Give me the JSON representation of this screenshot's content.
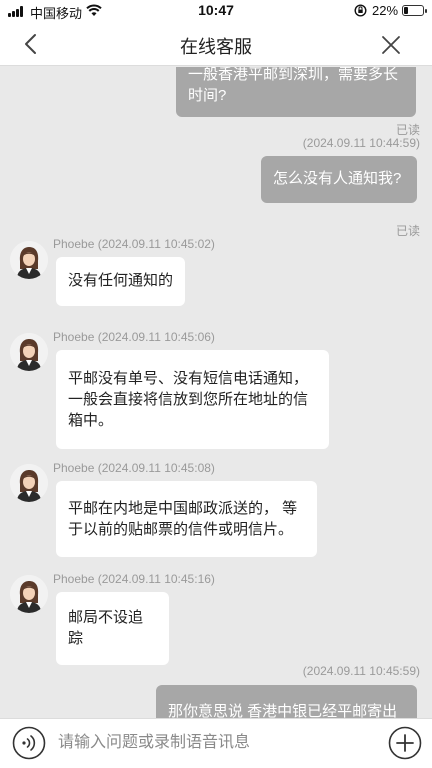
{
  "status_bar": {
    "carrier": "中国移动",
    "time": "10:47",
    "battery_text": "22%",
    "battery_level": 0.22
  },
  "nav": {
    "title": "在线客服"
  },
  "messages": [
    {
      "side": "out",
      "text": "一般香港平邮到深圳，需要多长时间?",
      "read": "已读",
      "time": "(2024.09.11 10:44:59)"
    },
    {
      "side": "out",
      "text": "怎么没有人通知我?",
      "read": "已读"
    },
    {
      "side": "in",
      "sender_time": "Phoebe (2024.09.11 10:45:02)",
      "text": "没有任何通知的"
    },
    {
      "side": "in",
      "sender_time": "Phoebe (2024.09.11 10:45:06)",
      "text": "平邮没有单号、没有短信电话通知，一般会直接将信放到您所在地址的信箱中。"
    },
    {
      "side": "in",
      "sender_time": "Phoebe (2024.09.11 10:45:08)",
      "text": "平邮在内地是中国邮政派送的， 等于以前的贴邮票的信件或明信片。"
    },
    {
      "side": "in",
      "sender_time": "Phoebe (2024.09.11 10:45:16)",
      "text": "邮局不设追踪"
    },
    {
      "side": "out",
      "time": "(2024.09.11 10:45:59)",
      "text": "那你意思说 香港中银已经平邮寄出"
    }
  ],
  "input": {
    "placeholder": "请输入问题或录制语音讯息"
  },
  "colors": {
    "outgoing_bubble": "#a7a7a7",
    "incoming_bubble": "#ffffff",
    "chat_background": "#e9e9e9"
  }
}
